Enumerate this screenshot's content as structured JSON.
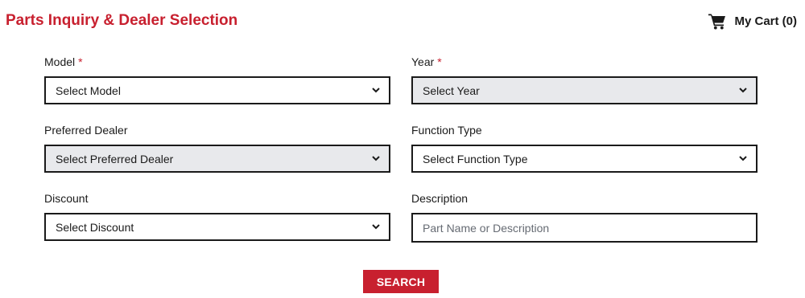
{
  "header": {
    "title": "Parts Inquiry & Dealer Selection",
    "cart_label": "My Cart (0)",
    "cart_icon": "shopping-cart-icon"
  },
  "form": {
    "model": {
      "label": "Model",
      "required_mark": "*",
      "selected": "Select Model"
    },
    "year": {
      "label": "Year",
      "required_mark": "*",
      "selected": "Select Year"
    },
    "preferred_dealer": {
      "label": "Preferred Dealer",
      "selected": "Select Preferred Dealer"
    },
    "function_type": {
      "label": "Function Type",
      "selected": "Select Function Type"
    },
    "discount": {
      "label": "Discount",
      "selected": "Select Discount"
    },
    "description": {
      "label": "Description",
      "placeholder": "Part Name or Description",
      "value": ""
    }
  },
  "actions": {
    "search_label": "SEARCH"
  },
  "colors": {
    "brand_red": "#c8202f",
    "disabled_bg": "#e8e9ec",
    "border": "#1a1a1a"
  }
}
